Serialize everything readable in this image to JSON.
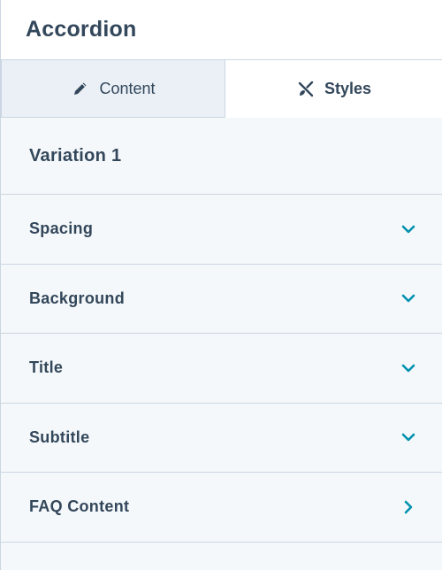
{
  "header": {
    "title": "Accordion"
  },
  "tabs": [
    {
      "label": "Content",
      "icon": "pencil-icon",
      "active": false
    },
    {
      "label": "Styles",
      "icon": "brush-icon",
      "active": true
    }
  ],
  "variation": {
    "title": "Variation 1"
  },
  "sections": [
    {
      "label": "Spacing",
      "chevron": "chevron-down-icon"
    },
    {
      "label": "Background",
      "chevron": "chevron-down-icon"
    },
    {
      "label": "Title",
      "chevron": "chevron-down-icon"
    },
    {
      "label": "Subtitle",
      "chevron": "chevron-down-icon"
    },
    {
      "label": "FAQ Content",
      "chevron": "chevron-right-icon"
    }
  ],
  "colors": {
    "text": "#33475b",
    "accent": "#0091ae",
    "border": "#cbd6e2",
    "panel_bg": "#f5f8fa",
    "tab_inactive_bg": "#eaf0f6"
  }
}
